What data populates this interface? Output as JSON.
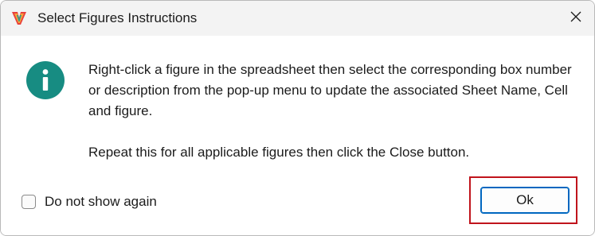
{
  "window": {
    "title": "Select Figures Instructions",
    "app_icon": "app-logo-icon",
    "close_icon": "close-icon"
  },
  "dialog": {
    "icon": "info-icon",
    "icon_color": "#178c82",
    "message_paragraph_1": "Right-click a figure in the spreadsheet then select the corresponding box number or description from the pop-up menu to update the associated Sheet Name, Cell and figure.",
    "message_paragraph_2": "Repeat this for all applicable figures then click the Close button."
  },
  "footer": {
    "checkbox_label": "Do not show again",
    "checkbox_checked": false,
    "ok_label": "Ok"
  },
  "colors": {
    "titlebar_bg": "#f3f3f3",
    "accent": "#0067c0",
    "highlight_border": "#c0141c"
  }
}
